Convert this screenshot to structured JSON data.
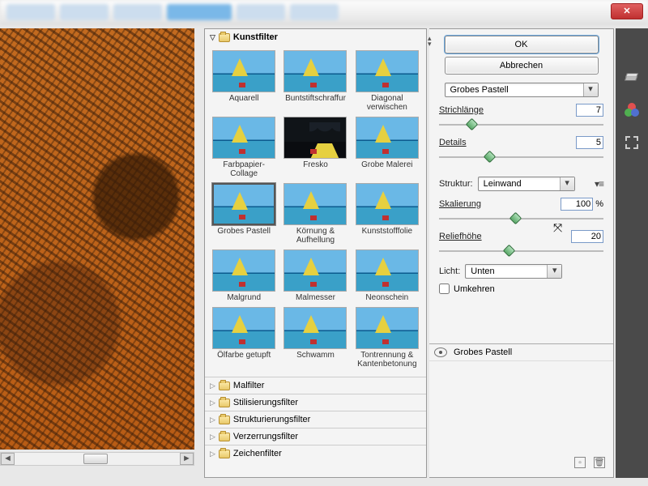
{
  "window": {
    "close": "✕"
  },
  "gallery": {
    "open_category": "Kunstfilter",
    "filters": [
      {
        "label": "Aquarell"
      },
      {
        "label": "Buntstiftschraffur"
      },
      {
        "label": "Diagonal verwischen"
      },
      {
        "label": "Farbpapier-Collage"
      },
      {
        "label": "Fresko",
        "dark": true
      },
      {
        "label": "Grobe Malerei"
      },
      {
        "label": "Grobes Pastell",
        "selected": true
      },
      {
        "label": "Körnung & Aufhellung"
      },
      {
        "label": "Kunststofffolie"
      },
      {
        "label": "Malgrund"
      },
      {
        "label": "Malmesser"
      },
      {
        "label": "Neonschein"
      },
      {
        "label": "Ölfarbe getupft"
      },
      {
        "label": "Schwamm"
      },
      {
        "label": "Tontrennung & Kantenbetonung"
      }
    ],
    "closed_categories": [
      "Malfilter",
      "Stilisierungsfilter",
      "Strukturierungsfilter",
      "Verzerrungsfilter",
      "Zeichenfilter"
    ]
  },
  "settings": {
    "ok": "OK",
    "cancel": "Abbrechen",
    "filter_name": "Grobes Pastell",
    "params": {
      "strichlaenge": {
        "label": "Strichlänge",
        "value": "7",
        "pos": 17
      },
      "details": {
        "label": "Details",
        "value": "5",
        "pos": 28
      }
    },
    "struktur": {
      "label": "Struktur:",
      "value": "Leinwand"
    },
    "skalierung": {
      "label": "Skalierung",
      "value": "100",
      "unit": "%",
      "pos": 44
    },
    "reliefhoehe": {
      "label": "Reliefhöhe",
      "value": "20",
      "pos": 40
    },
    "licht": {
      "label": "Licht:",
      "value": "Unten"
    },
    "umkehren": {
      "label": "Umkehren",
      "checked": false
    }
  },
  "layer": {
    "name": "Grobes Pastell"
  }
}
